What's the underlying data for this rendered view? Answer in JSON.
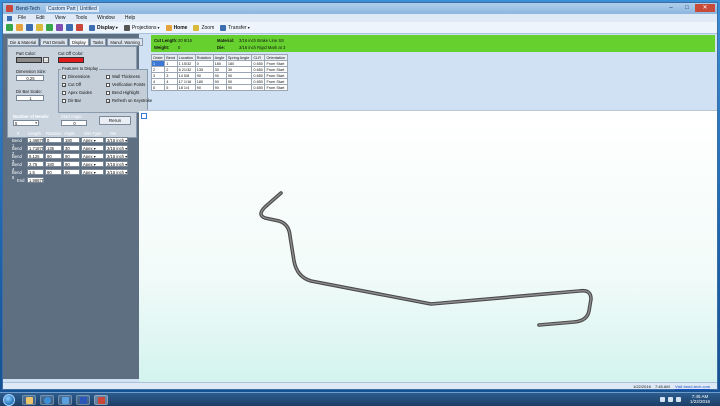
{
  "window": {
    "title": "Bend-Tech",
    "subtitle": "Custom Part | Untitled"
  },
  "menu": [
    "File",
    "Edit",
    "View",
    "Tools",
    "Window",
    "Help"
  ],
  "toolbar": {
    "display": "Display",
    "projections": "Projections",
    "home": "Home",
    "zoom": "Zoom",
    "transfer": "Transfer"
  },
  "tabs": [
    "Die & Material",
    "Part Details",
    "Display",
    "Tasks",
    "Manuf. Warning"
  ],
  "display_tab": {
    "part_color": "Part Color:",
    "cut_off_color": "Cut Off Color:",
    "part_color_hex": "#8a8a8a",
    "cut_off_color_hex": "#e11b1b",
    "dimension_size_label": "Dimension Size:",
    "dimension_size_value": "0.25",
    "dir_bar_scale_label": "Dir Bar Scale:",
    "dir_bar_scale_value": "1",
    "features_label": "Features to Display",
    "features": [
      {
        "label": "Dimensions",
        "checked": false
      },
      {
        "label": "Wall Thickness",
        "checked": false
      },
      {
        "label": "Cut Off",
        "checked": true
      },
      {
        "label": "Verification Points",
        "checked": false
      },
      {
        "label": "Apex Guides",
        "checked": false
      },
      {
        "label": "Bend Highlight",
        "checked": false
      },
      {
        "label": "Dir Bar",
        "checked": false
      },
      {
        "label": "Refresh on Keystroke",
        "checked": true
      }
    ]
  },
  "bends_control": {
    "number_label": "Number of Bends:",
    "number_value": "5",
    "start_angle_label": "Start Angle:",
    "start_angle_value": "0",
    "rerun_button": "Rerun"
  },
  "bend_grid": {
    "headers": [
      "#",
      "Length",
      "Rotation",
      "Angle",
      "Dim Type",
      "Die"
    ],
    "rows": [
      {
        "label": "Bend 1",
        "length": "1.46875",
        "rotation": "0",
        "angle": "180",
        "dimtype": "Apex",
        "die": "3/16 inch"
      },
      {
        "label": "Bend 2",
        "length": "1.71875",
        "rotation": "135",
        "angle": "30",
        "dimtype": "Apex",
        "die": "3/16 inch"
      },
      {
        "label": "Bend 3",
        "length": "9.125",
        "rotation": "90",
        "angle": "90",
        "dimtype": "Apex",
        "die": "3/16 inch"
      },
      {
        "label": "Bend 4",
        "length": "2.75",
        "rotation": "180",
        "angle": "90",
        "dimtype": "Apex",
        "die": "3/16 inch"
      },
      {
        "label": "Bend 5",
        "length": "1.5",
        "rotation": "90",
        "angle": "90",
        "dimtype": "Apex",
        "die": "3/16 inch"
      }
    ],
    "end_label": "End",
    "end_value": "1.96875"
  },
  "info": {
    "cut_length_label": "Cut Length:",
    "cut_length_value": "20 9/16",
    "weight_label": "Weight:",
    "weight_value": "0",
    "material_label": "Material:",
    "material_value": "3/16 inch Brake Line SS",
    "die_label": "Die:",
    "die_value": "3/16 inch Rigid Mark at 3"
  },
  "bend_table": {
    "headers": [
      "Order",
      "Bend",
      "Location",
      "Rotation",
      "Angle",
      "Spring Angle",
      "CLR",
      "Orientation"
    ],
    "rows": [
      [
        "1",
        "1",
        "1 15/32",
        "0",
        "180",
        "180",
        "0.650",
        "From Start"
      ],
      [
        "2",
        "2",
        "6 21/32",
        "135",
        "30",
        "30",
        "0.650",
        "From Start"
      ],
      [
        "3",
        "3",
        "14 5/8",
        "90",
        "90",
        "90",
        "0.650",
        "From Start"
      ],
      [
        "4",
        "4",
        "17 1/16",
        "180",
        "90",
        "90",
        "0.650",
        "From Start"
      ],
      [
        "5",
        "5",
        "18 1/4",
        "90",
        "90",
        "90",
        "0.650",
        "From Start"
      ]
    ]
  },
  "status": {
    "date": "1/22/2016",
    "time": "7:45 AM",
    "link": "Visit bend-tech.com"
  },
  "taskbar": {
    "clock_time": "7:45 AM",
    "clock_date": "1/22/2016"
  }
}
